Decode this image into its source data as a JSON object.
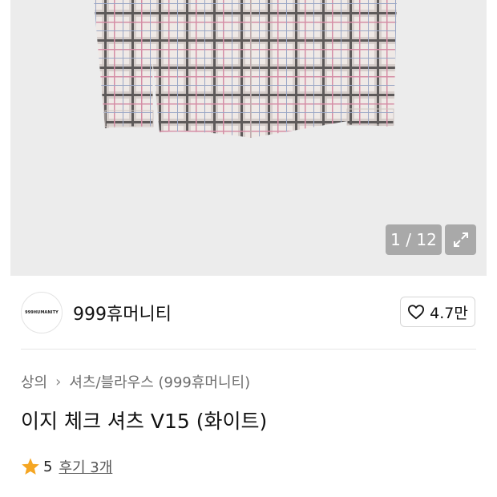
{
  "gallery": {
    "counter": "1 / 12"
  },
  "brand": {
    "logo_text": "999HUMANITY",
    "name": "999휴머니티",
    "like_count": "4.7만"
  },
  "breadcrumb": {
    "level1": "상의",
    "level2": "셔츠/블라우스 (999휴머니티)"
  },
  "product": {
    "title": "이지 체크 셔츠 V15 (화이트)"
  },
  "rating": {
    "score": "5",
    "review_link": "후기 3개"
  },
  "colors": {
    "star": "#F5A623",
    "overlay": "#969696"
  }
}
